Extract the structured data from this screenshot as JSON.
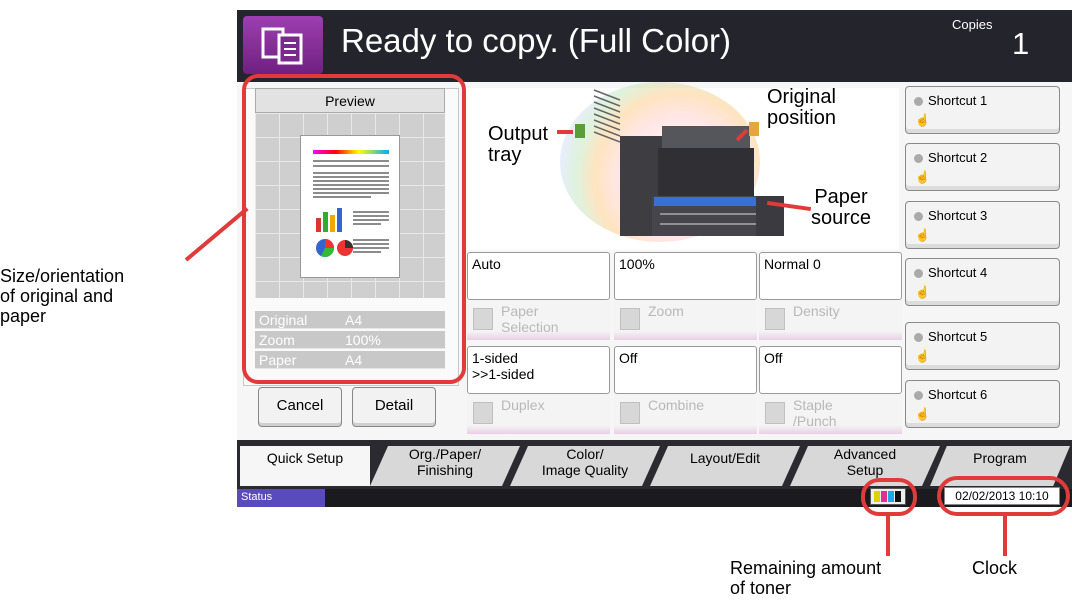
{
  "header": {
    "title": "Ready to copy. (Full Color)",
    "copies_label": "Copies",
    "copies_value": "1"
  },
  "preview": {
    "title": "Preview",
    "info": [
      {
        "label": "Original",
        "value": "A4"
      },
      {
        "label": "Zoom",
        "value": "100%"
      },
      {
        "label": "Paper",
        "value": "A4"
      }
    ],
    "cancel_label": "Cancel",
    "detail_label": "Detail"
  },
  "machine": {
    "output_tray": "Output\ntray",
    "original_position": "Original\nposition",
    "paper_source": "Paper\nsource"
  },
  "functions": [
    {
      "value": "Auto",
      "name": "Paper\nSelection"
    },
    {
      "value": "100%",
      "name": "Zoom"
    },
    {
      "value": "Normal 0",
      "name": "Density"
    },
    {
      "value": "1-sided\n>>1-sided",
      "name": "Duplex"
    },
    {
      "value": "Off",
      "name": "Combine"
    },
    {
      "value": "Off",
      "name": "Staple\n/Punch"
    }
  ],
  "shortcuts": [
    "Shortcut 1",
    "Shortcut 2",
    "Shortcut 3",
    "Shortcut 4",
    "Shortcut 5",
    "Shortcut 6"
  ],
  "tabs": [
    "Quick Setup",
    "Org./Paper/\nFinishing",
    "Color/\nImage Quality",
    "Layout/Edit",
    "Advanced\nSetup",
    "Program"
  ],
  "status": {
    "label": "Status",
    "clock": "02/02/2013  10:10"
  },
  "callouts": {
    "size_orientation": "Size/orientation\nof original and\npaper",
    "toner": "Remaining amount\nof toner",
    "clock": "Clock"
  },
  "colors": {
    "accent_red": "#e03a3a",
    "header_bg": "#24242c",
    "status_purple": "#5a4bbd"
  }
}
